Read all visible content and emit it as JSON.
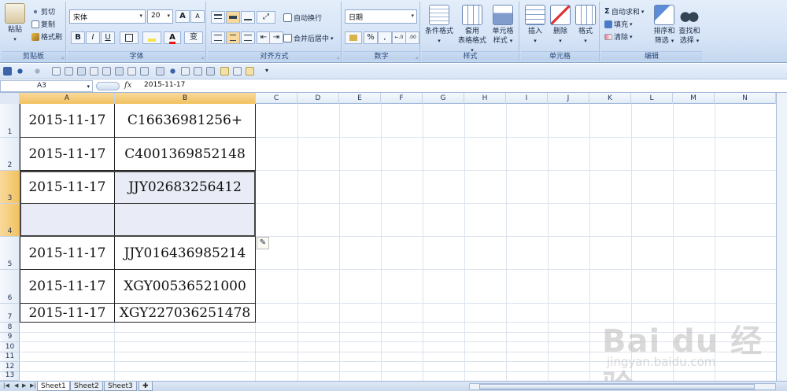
{
  "ribbon": {
    "clipboard": {
      "paste": "粘贴",
      "cut": "剪切",
      "copy": "复制",
      "format_painter": "格式刷",
      "label": "剪贴板"
    },
    "font": {
      "name": "宋体",
      "size": "20",
      "label": "字体",
      "bold": "B",
      "italic": "I",
      "underline": "U",
      "grow": "A",
      "shrink": "A",
      "phonetic": "变"
    },
    "alignment": {
      "wrap": "自动换行",
      "merge": "合并后居中",
      "label": "对齐方式"
    },
    "number": {
      "format": "日期",
      "percent": "%",
      "comma": ",",
      "label": "数字",
      "inc_decimal": "←.0",
      "dec_decimal": ".00"
    },
    "styles": {
      "conditional": "条件格式",
      "table_line1": "套用",
      "table_line2": "表格格式",
      "cell_line1": "单元格",
      "cell_line2": "样式",
      "label": "样式"
    },
    "cells": {
      "insert": "插入",
      "delete": "删除",
      "format": "格式",
      "label": "单元格"
    },
    "editing": {
      "autosum": "自动求和",
      "fill": "填充",
      "clear": "清除",
      "sort_line1": "排序和",
      "sort_line2": "筛选",
      "find_line1": "查找和",
      "find_line2": "选择",
      "label": "编辑"
    },
    "dropdown_arrow": "▾"
  },
  "formula_bar": {
    "name_box": "A3",
    "fx": "fx",
    "content": "2015-11-17"
  },
  "columns": [
    "A",
    "B",
    "C",
    "D",
    "E",
    "F",
    "G",
    "H",
    "I",
    "J",
    "K",
    "L",
    "M",
    "N"
  ],
  "rows": [
    "1",
    "2",
    "3",
    "4",
    "5",
    "6",
    "7",
    "8",
    "9",
    "10",
    "11",
    "12",
    "13"
  ],
  "cells": [
    {
      "a": "2015-11-17",
      "b": "C16636981256+"
    },
    {
      "a": "2015-11-17",
      "b": "C4001369852148"
    },
    {
      "a": "2015-11-17",
      "b": "JJY02683256412"
    },
    {
      "a": "",
      "b": ""
    },
    {
      "a": "2015-11-17",
      "b": "JJY016436985214"
    },
    {
      "a": "2015-11-17",
      "b": "XGY00536521000"
    },
    {
      "a": "2015-11-17",
      "b": "XGY227036251478"
    }
  ],
  "sheets": [
    "Sheet1",
    "Sheet2",
    "Sheet3"
  ],
  "watermark": {
    "brand": "Bai du 经验",
    "url": "jingyan.baidu.com"
  },
  "colors": {
    "selected_header": "#f1c15f",
    "selection_fill": "#e9ecf6",
    "ribbon_bg": "#d6e4f6"
  }
}
